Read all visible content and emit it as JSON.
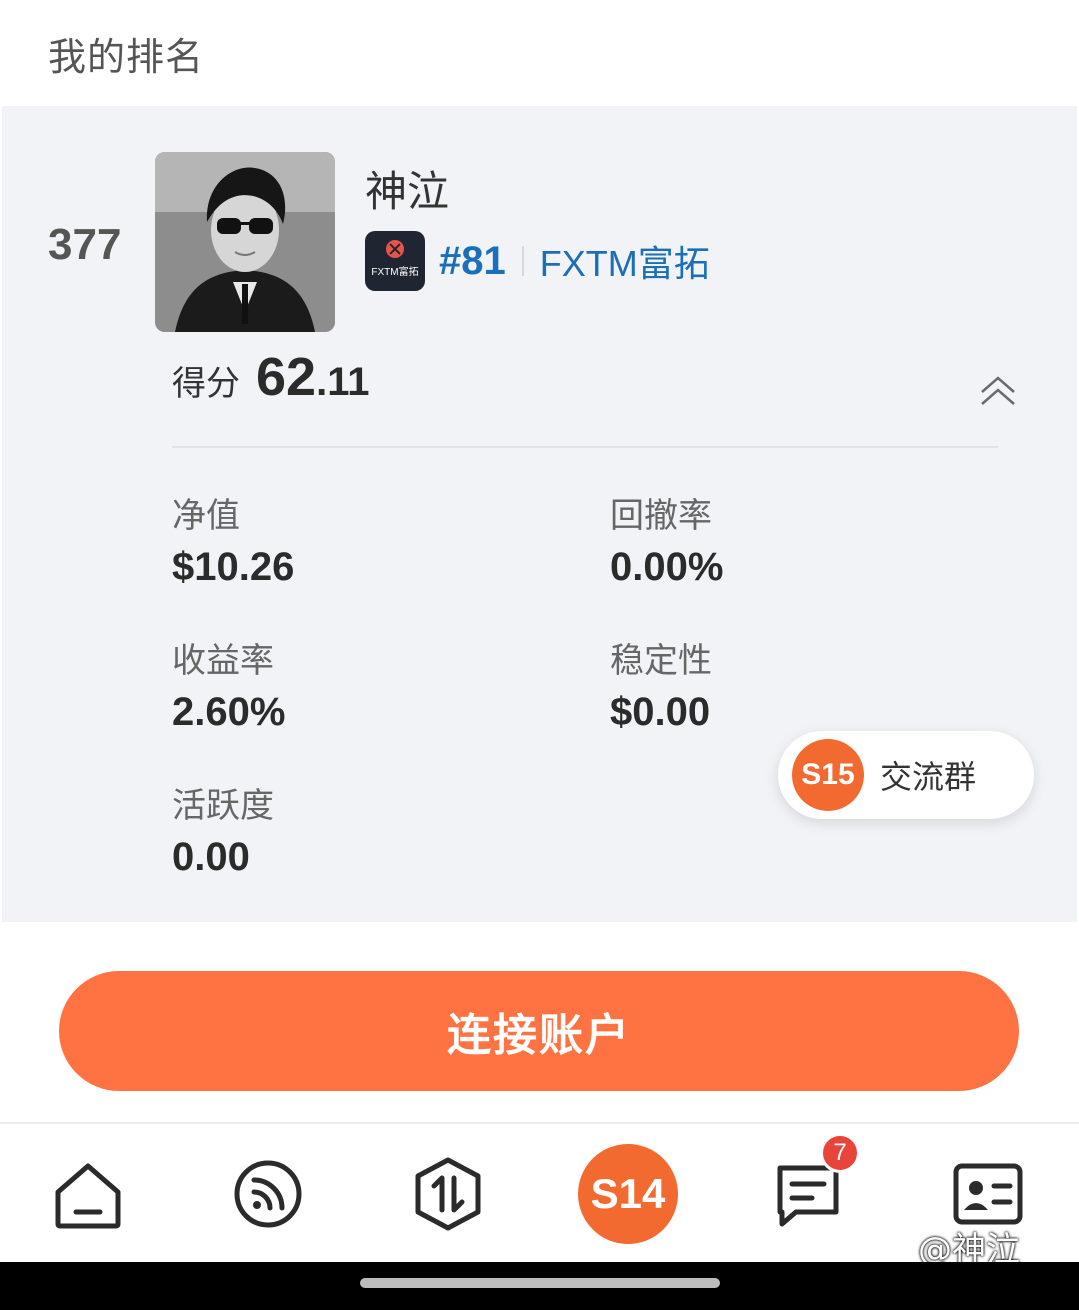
{
  "header": {
    "title": "我的排名"
  },
  "profile": {
    "rank": "377",
    "username": "神泣",
    "broker_rank": "#81",
    "broker_name": "FXTM富拓",
    "broker_logo_text": "FXTM富拓"
  },
  "score": {
    "label": "得分",
    "major": "62",
    "minor": ".11"
  },
  "stats": [
    {
      "label": "净值",
      "value": "$10.26"
    },
    {
      "label": "回撤率",
      "value": "0.00%"
    },
    {
      "label": "收益率",
      "value": "2.60%"
    },
    {
      "label": "稳定性",
      "value": "$0.00"
    },
    {
      "label": "活跃度",
      "value": "0.00"
    }
  ],
  "group_chip": {
    "logo": "S15",
    "label": "交流群"
  },
  "connect_button": {
    "label": "连接账户"
  },
  "bottom_nav": {
    "items": [
      {
        "icon": "home-icon"
      },
      {
        "icon": "feed-icon"
      },
      {
        "icon": "trade-icon"
      },
      {
        "icon": "s14-icon",
        "label": "S14"
      },
      {
        "icon": "messages-icon",
        "badge": "7"
      },
      {
        "icon": "profile-card-icon"
      }
    ]
  },
  "watermark": "@神泣",
  "colors": {
    "accent": "#ff7241",
    "link": "#1a6fb8",
    "card_bg": "#f1f3f6"
  }
}
